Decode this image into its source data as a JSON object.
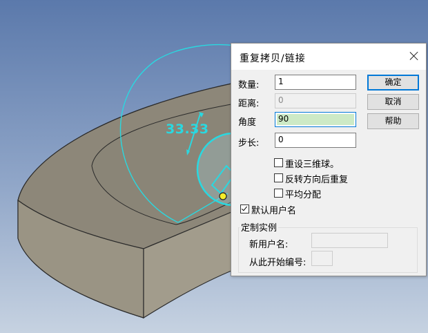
{
  "dialog": {
    "title": "重复拷贝/链接",
    "fields": {
      "count_label": "数量:",
      "count_value": "1",
      "distance_label": "距离:",
      "distance_value": "0",
      "angle_label": "角度",
      "angle_value": "90",
      "step_label": "步长:",
      "step_value": "0"
    },
    "buttons": {
      "ok": "确定",
      "cancel": "取消",
      "help": "帮助"
    },
    "checkboxes": {
      "reset_ball": "重设三维球。",
      "reverse_repeat": "反转方向后重复",
      "even_distribute": "平均分配",
      "default_user_name": "默认用户名"
    },
    "checked": {
      "reset_ball": false,
      "reverse_repeat": false,
      "even_distribute": false,
      "default_user_name": true
    },
    "custom_group": {
      "legend": "定制实例",
      "new_user_name_label": "新用户名:",
      "start_number_label": "从此开始编号:"
    }
  },
  "viewport": {
    "dimension_text": "33.33",
    "colors": {
      "handle": "#2ad8e0",
      "part_face": "#8e887a",
      "part_side": "#9b9585",
      "background_top": "#5b79ab"
    }
  }
}
